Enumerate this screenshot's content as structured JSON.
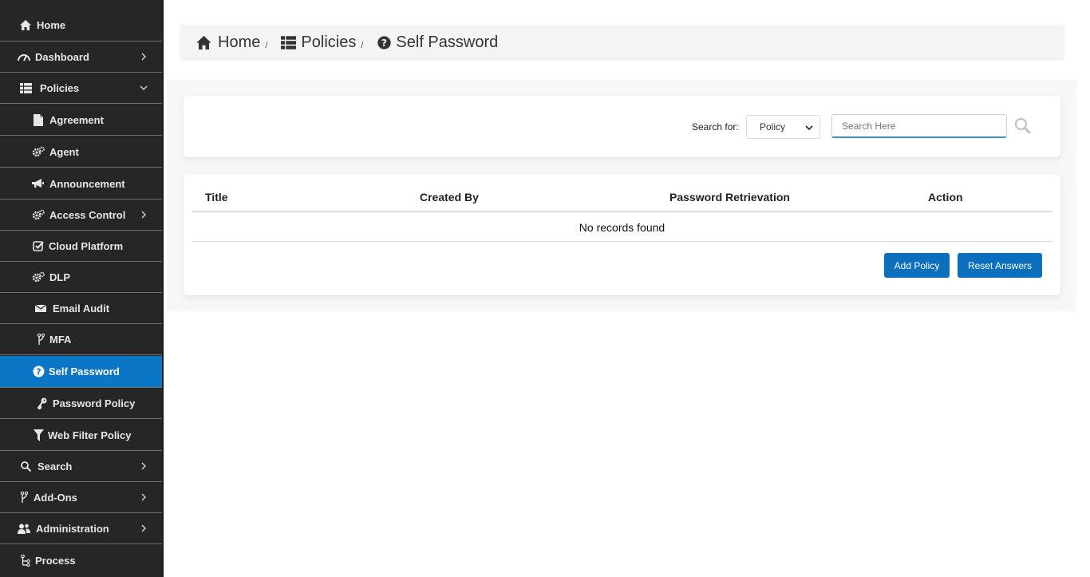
{
  "sidebar": {
    "items": [
      {
        "label": "Home",
        "icon": "home-icon"
      },
      {
        "label": "Dashboard",
        "icon": "gauge-icon"
      },
      {
        "label": "Policies",
        "icon": "list-icon"
      },
      {
        "label": "Agreement",
        "icon": "file-icon"
      },
      {
        "label": "Agent",
        "icon": "cogs-icon"
      },
      {
        "label": "Announcement",
        "icon": "bullhorn-icon"
      },
      {
        "label": "Access Control",
        "icon": "cogs-icon"
      },
      {
        "label": "Cloud Platform",
        "icon": "check-square-icon"
      },
      {
        "label": "DLP",
        "icon": "cogs-icon"
      },
      {
        "label": "Email Audit",
        "icon": "envelope-icon"
      },
      {
        "label": "MFA",
        "icon": "fork-icon"
      },
      {
        "label": "Self Password",
        "icon": "question-circle-icon"
      },
      {
        "label": "Password Policy",
        "icon": "key-icon"
      },
      {
        "label": "Web Filter Policy",
        "icon": "filter-icon"
      },
      {
        "label": "Search",
        "icon": "search-icon"
      },
      {
        "label": "Add-Ons",
        "icon": "fork-icon"
      },
      {
        "label": "Administration",
        "icon": "users-icon"
      },
      {
        "label": "Process",
        "icon": "sitemap-icon"
      }
    ]
  },
  "breadcrumb": {
    "home": "Home",
    "policies": "Policies",
    "current": "Self Password",
    "separator": "/"
  },
  "search": {
    "label": "Search for:",
    "selected": "Policy",
    "placeholder": "Search Here"
  },
  "table": {
    "columns": [
      "Title",
      "Created By",
      "Password Retrievation",
      "Action"
    ],
    "empty_text": "No records found"
  },
  "actions": {
    "add_policy": "Add Policy",
    "reset_answers": "Reset Answers"
  },
  "colors": {
    "sidebar_bg": "#262626",
    "active_bg": "#0b76c5",
    "button_bg": "#0b6fbd"
  }
}
